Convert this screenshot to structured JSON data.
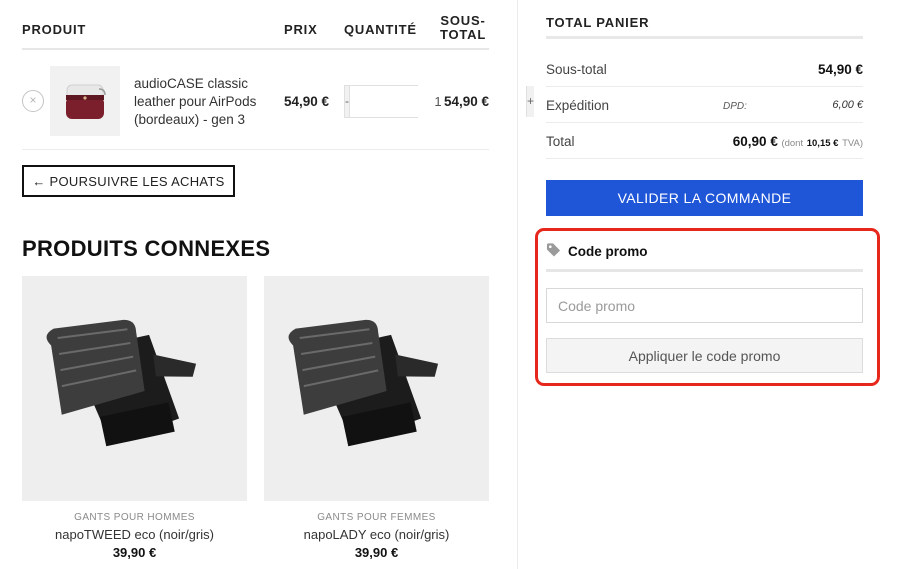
{
  "cart_table": {
    "headers": {
      "product": "PRODUIT",
      "price": "PRIX",
      "quantity": "QUANTITÉ",
      "subtotal_line1": "SOUS-",
      "subtotal_line2": "TOTAL"
    },
    "items": [
      {
        "remove_symbol": "×",
        "name": "audioCASE classic leather pour AirPods (bordeaux) - gen 3",
        "price": "54,90 €",
        "qty_minus": "-",
        "qty_value": "1",
        "qty_plus": "+",
        "subtotal": "54,90 €",
        "icon": "airpods-case-image"
      }
    ],
    "continue_shopping": "← POURSUIVRE LES ACHATS"
  },
  "related": {
    "title": "PRODUITS CONNEXES",
    "products": [
      {
        "category": "GANTS POUR HOMMES",
        "name": "napoTWEED eco (noir/gris)",
        "price": "39,90 €",
        "icon": "gloves-image"
      },
      {
        "category": "GANTS POUR FEMMES",
        "name": "napoLADY eco (noir/gris)",
        "price": "39,90 €",
        "icon": "gloves-image"
      }
    ]
  },
  "totals": {
    "title": "TOTAL PANIER",
    "subtotal_label": "Sous-total",
    "subtotal_value": "54,90 €",
    "shipping_label": "Expédition",
    "shipping_method": "DPD:",
    "shipping_value": "6,00 €",
    "total_label": "Total",
    "total_value": "60,90 €",
    "tax_prefix": "(dont",
    "tax_value": "10,15 €",
    "tax_suffix": "TVA)",
    "checkout_button": "VALIDER LA COMMANDE"
  },
  "promo": {
    "title": "Code promo",
    "icon": "tag-icon",
    "placeholder": "Code promo",
    "value": "",
    "apply_button": "Appliquer le code promo",
    "highlight_color": "#e8271c"
  },
  "colors": {
    "accent": "#1f56d8",
    "highlight": "#e8271c"
  }
}
